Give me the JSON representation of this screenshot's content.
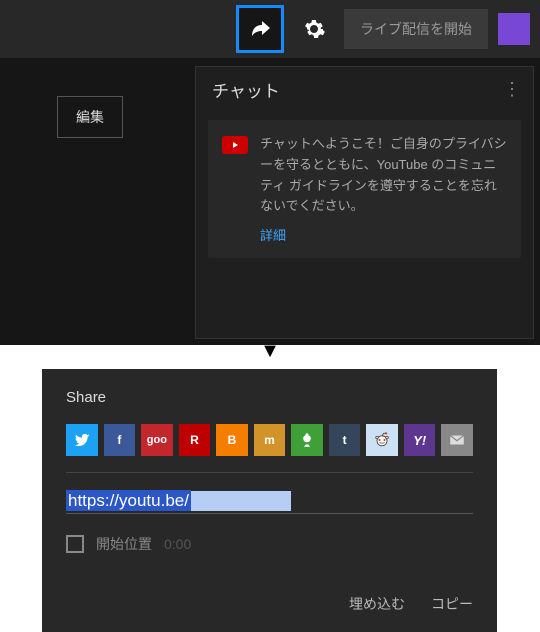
{
  "header": {
    "start_live_label": "ライブ配信を開始"
  },
  "sidebar": {
    "edit_label": "編集"
  },
  "chat": {
    "title": "チャット",
    "welcome_text": "チャットへようこそ！ご自身のプライバシーを守るとともに、YouTube のコミュニティ ガイドラインを遵守することを忘れないでください。",
    "details_label": "詳細"
  },
  "share": {
    "title": "Share",
    "services": {
      "twitter": "t",
      "facebook": "f",
      "goo": "goo",
      "rakuten": "R",
      "blogger": "B",
      "mixi": "m",
      "ameba": "",
      "tumblr": "t",
      "reddit": "",
      "yahoo": "Y!",
      "mail": ""
    },
    "url_visible": "https://youtu.be/",
    "start_pos_label": "開始位置",
    "start_time": "0:00",
    "embed_label": "埋め込む",
    "copy_label": "コピー"
  }
}
